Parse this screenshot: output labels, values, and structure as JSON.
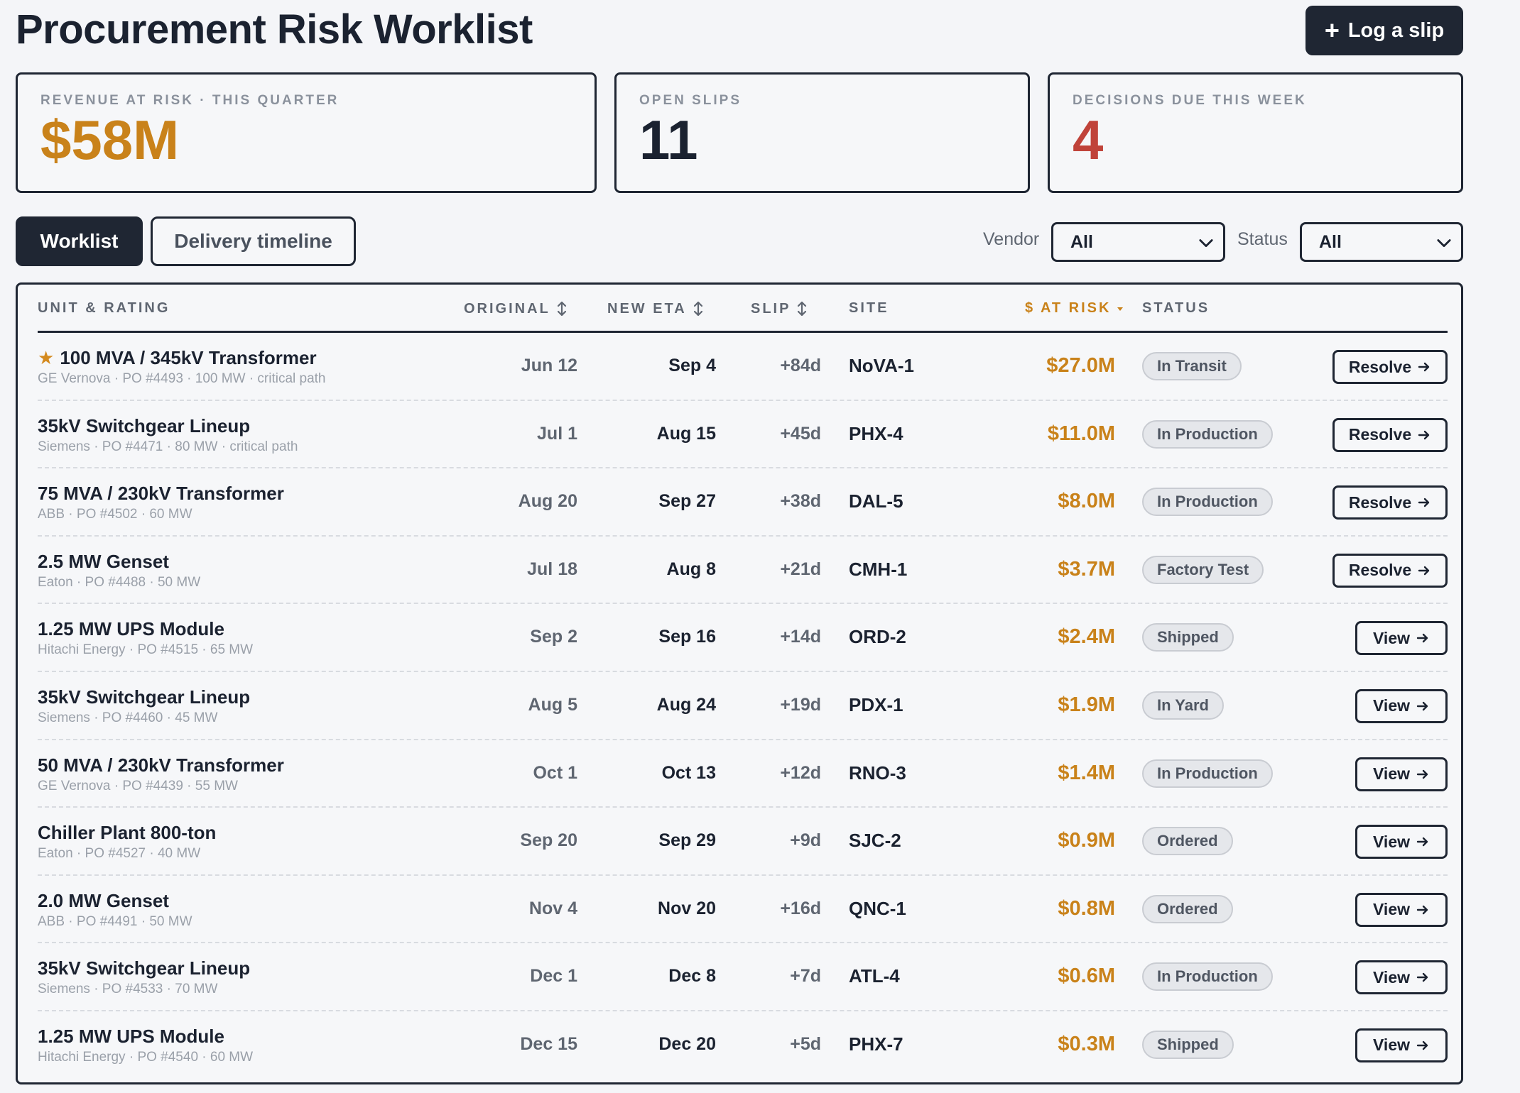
{
  "header": {
    "title": "Procurement Risk Worklist",
    "log_button": "Log a slip",
    "plus_symbol": "+"
  },
  "kpis": {
    "revenue": {
      "label": "REVENUE AT RISK · THIS QUARTER",
      "value": "$58M",
      "color": "#c9821a"
    },
    "slips": {
      "label": "OPEN SLIPS",
      "value": "11",
      "color": "#1b2230"
    },
    "decisions": {
      "label": "DECISIONS DUE THIS WEEK",
      "value": "4",
      "color": "#c0433a"
    }
  },
  "tabs": {
    "worklist": "Worklist",
    "timeline": "Delivery timeline",
    "active": "worklist"
  },
  "filters": {
    "vendor_label": "Vendor",
    "vendor_value": "All",
    "status_label": "Status",
    "status_value": "All"
  },
  "table": {
    "columns": {
      "unit": "UNIT & RATING",
      "original": "ORIGINAL",
      "new_eta": "NEW ETA",
      "slip": "SLIP",
      "site": "SITE",
      "at_risk": "$ AT RISK",
      "status": "STATUS"
    },
    "sorted_by": "at_risk",
    "sort_direction": "descending",
    "rows": [
      {
        "starred": true,
        "unit": "100 MVA / 345kV Transformer",
        "meta": "GE Vernova · PO #4493 · 100 MW · critical path",
        "original": "Jun 12",
        "new_eta": "Sep 4",
        "slip": "+84d",
        "site": "NoVA-1",
        "at_risk": "$27.0M",
        "status": "In Transit",
        "action": "Resolve",
        "action_type": "resolve"
      },
      {
        "starred": false,
        "unit": "35kV Switchgear Lineup",
        "meta": "Siemens · PO #4471 · 80 MW · critical path",
        "original": "Jul 1",
        "new_eta": "Aug 15",
        "slip": "+45d",
        "site": "PHX-4",
        "at_risk": "$11.0M",
        "status": "In Production",
        "action": "Resolve",
        "action_type": "resolve"
      },
      {
        "starred": false,
        "unit": "75 MVA / 230kV Transformer",
        "meta": "ABB · PO #4502 · 60 MW",
        "original": "Aug 20",
        "new_eta": "Sep 27",
        "slip": "+38d",
        "site": "DAL-5",
        "at_risk": "$8.0M",
        "status": "In Production",
        "action": "Resolve",
        "action_type": "resolve"
      },
      {
        "starred": false,
        "unit": "2.5 MW Genset",
        "meta": "Eaton · PO #4488 · 50 MW",
        "original": "Jul 18",
        "new_eta": "Aug 8",
        "slip": "+21d",
        "site": "CMH-1",
        "at_risk": "$3.7M",
        "status": "Factory Test",
        "action": "Resolve",
        "action_type": "resolve"
      },
      {
        "starred": false,
        "unit": "1.25 MW UPS Module",
        "meta": "Hitachi Energy · PO #4515 · 65 MW",
        "original": "Sep 2",
        "new_eta": "Sep 16",
        "slip": "+14d",
        "site": "ORD-2",
        "at_risk": "$2.4M",
        "status": "Shipped",
        "action": "View",
        "action_type": "view"
      },
      {
        "starred": false,
        "unit": "35kV Switchgear Lineup",
        "meta": "Siemens · PO #4460 · 45 MW",
        "original": "Aug 5",
        "new_eta": "Aug 24",
        "slip": "+19d",
        "site": "PDX-1",
        "at_risk": "$1.9M",
        "status": "In Yard",
        "action": "View",
        "action_type": "view"
      },
      {
        "starred": false,
        "unit": "50 MVA / 230kV Transformer",
        "meta": "GE Vernova · PO #4439 · 55 MW",
        "original": "Oct 1",
        "new_eta": "Oct 13",
        "slip": "+12d",
        "site": "RNO-3",
        "at_risk": "$1.4M",
        "status": "In Production",
        "action": "View",
        "action_type": "view"
      },
      {
        "starred": false,
        "unit": "Chiller Plant 800-ton",
        "meta": "Eaton · PO #4527 · 40 MW",
        "original": "Sep 20",
        "new_eta": "Sep 29",
        "slip": "+9d",
        "site": "SJC-2",
        "at_risk": "$0.9M",
        "status": "Ordered",
        "action": "View",
        "action_type": "view"
      },
      {
        "starred": false,
        "unit": "2.0 MW Genset",
        "meta": "ABB · PO #4491 · 50 MW",
        "original": "Nov 4",
        "new_eta": "Nov 20",
        "slip": "+16d",
        "site": "QNC-1",
        "at_risk": "$0.8M",
        "status": "Ordered",
        "action": "View",
        "action_type": "view"
      },
      {
        "starred": false,
        "unit": "35kV Switchgear Lineup",
        "meta": "Siemens · PO #4533 · 70 MW",
        "original": "Dec 1",
        "new_eta": "Dec 8",
        "slip": "+7d",
        "site": "ATL-4",
        "at_risk": "$0.6M",
        "status": "In Production",
        "action": "View",
        "action_type": "view"
      },
      {
        "starred": false,
        "unit": "1.25 MW UPS Module",
        "meta": "Hitachi Energy · PO #4540 · 60 MW",
        "original": "Dec 15",
        "new_eta": "Dec 20",
        "slip": "+5d",
        "site": "PHX-7",
        "at_risk": "$0.3M",
        "status": "Shipped",
        "action": "View",
        "action_type": "view"
      }
    ]
  },
  "icons": {
    "star": "star-icon",
    "sort": "sort-icon",
    "sort_desc": "sort-desc-icon",
    "arrow": "arrow-right-icon",
    "chevron": "chevron-down-icon"
  },
  "colors": {
    "primary_dark": "#1f2633",
    "accent_amber": "#c9821a",
    "alert_red": "#c0433a",
    "background": "#f4f5f8"
  }
}
